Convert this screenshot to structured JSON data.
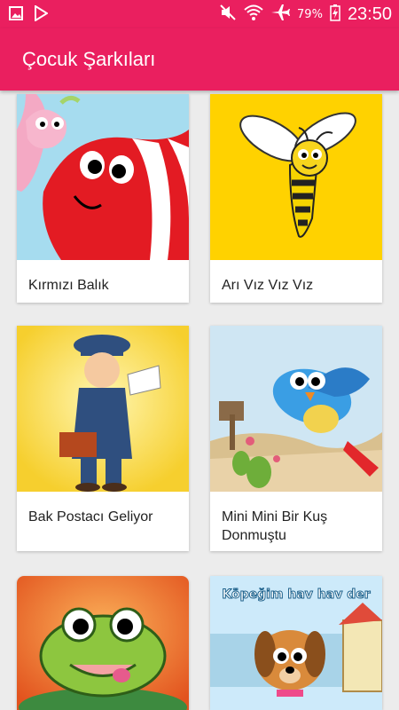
{
  "status_bar": {
    "battery": "79%",
    "time": "23:50",
    "icons": [
      "gallery-icon",
      "play-store-icon",
      "mute-icon",
      "wifi-icon",
      "airplane-icon",
      "battery-icon"
    ]
  },
  "app_bar": {
    "title": "Çocuk Şarkıları"
  },
  "theme": {
    "primary": "#ea1f5f",
    "background": "#ececec",
    "card": "#ffffff"
  },
  "songs": [
    {
      "title": "Kırmızı Balık",
      "thumb_bg": "#a6dcef"
    },
    {
      "title": "Arı Vız Vız Vız",
      "thumb_bg": "#ffd200"
    },
    {
      "title": "Bak Postacı Geliyor",
      "thumb_bg": "#fbe35c"
    },
    {
      "title": "Mini Mini Bir Kuş Donmuştu",
      "thumb_bg": "#cfe6f3"
    },
    {
      "title": "",
      "thumb_bg": "#f08a3c"
    },
    {
      "title": "",
      "thumb_bg": "#cdeafa",
      "thumb_caption": "Köpeğim hav hav der"
    }
  ]
}
